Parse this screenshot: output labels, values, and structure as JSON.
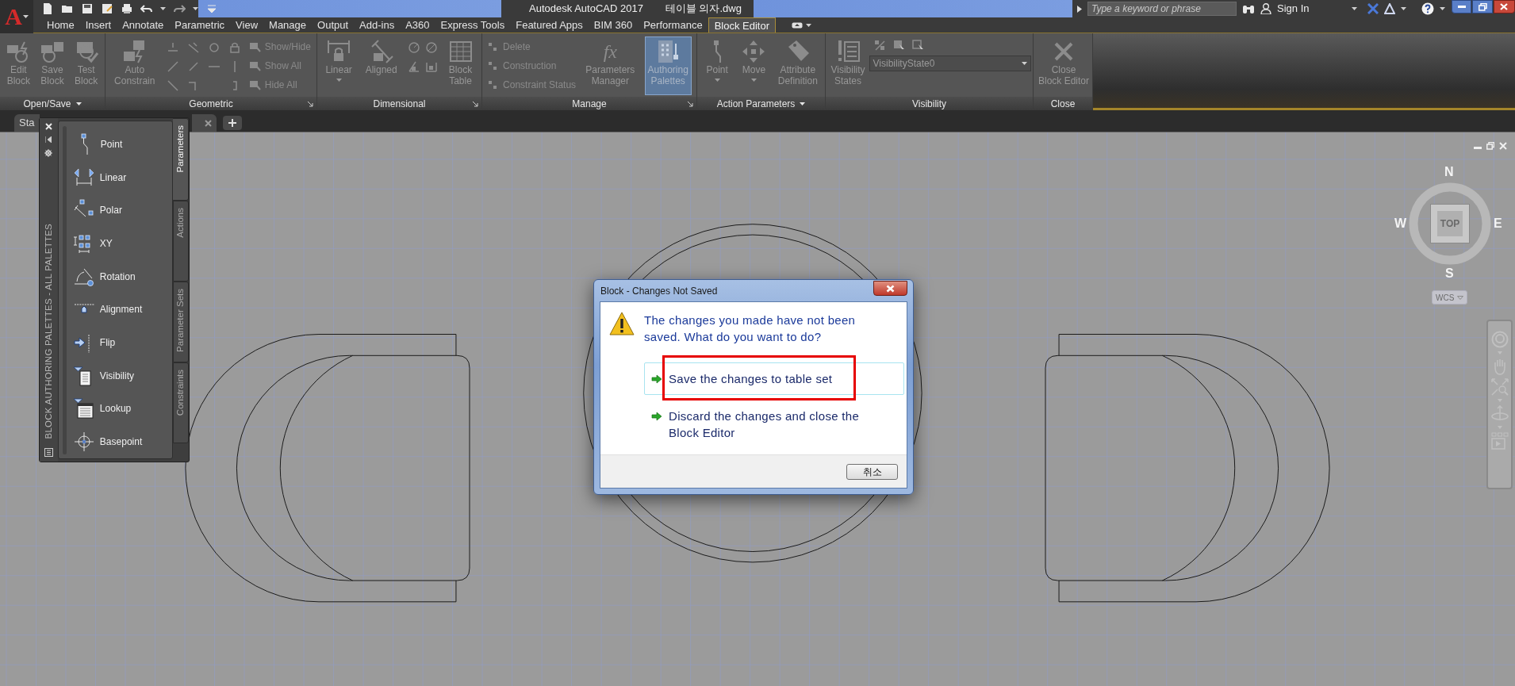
{
  "app_menu": {
    "label": "A"
  },
  "title_bar": {
    "app_title": "Autodesk AutoCAD 2017",
    "file_name": "테이블 의자.dwg",
    "search": {
      "placeholder": "Type a keyword or phrase"
    },
    "sign_in": "Sign In"
  },
  "ribbon_tabs": [
    {
      "label": "Home",
      "selected": false
    },
    {
      "label": "Insert",
      "selected": false
    },
    {
      "label": "Annotate",
      "selected": false
    },
    {
      "label": "Parametric",
      "selected": false
    },
    {
      "label": "View",
      "selected": false
    },
    {
      "label": "Manage",
      "selected": false
    },
    {
      "label": "Output",
      "selected": false
    },
    {
      "label": "Add-ins",
      "selected": false
    },
    {
      "label": "A360",
      "selected": false
    },
    {
      "label": "Express Tools",
      "selected": false
    },
    {
      "label": "Featured Apps",
      "selected": false
    },
    {
      "label": "BIM 360",
      "selected": false
    },
    {
      "label": "Performance",
      "selected": false
    },
    {
      "label": "Block Editor",
      "selected": true
    }
  ],
  "ribbon_panels": [
    {
      "label": "Open/Save",
      "menu": true,
      "launcher": false,
      "items": [
        {
          "kind": "large",
          "label": "Edit\nBlock",
          "active": false,
          "dropdown": false
        },
        {
          "kind": "large",
          "label": "Save\nBlock",
          "active": false,
          "dropdown": false
        },
        {
          "kind": "large",
          "label": "Test\nBlock",
          "active": false,
          "dropdown": false
        }
      ]
    },
    {
      "label": "Geometric",
      "menu": false,
      "launcher": true,
      "items": [
        {
          "kind": "large",
          "label": "Auto\nConstrain",
          "active": false,
          "dropdown": false
        },
        {
          "kind": "icon_grid"
        },
        {
          "kind": "small_list",
          "labels": [
            "Show/Hide",
            "Show All",
            "Hide All"
          ]
        }
      ]
    },
    {
      "label": "Dimensional",
      "menu": false,
      "launcher": true,
      "items": [
        {
          "kind": "large",
          "label": "Linear",
          "active": false,
          "dropdown": true
        },
        {
          "kind": "large",
          "label": "Aligned",
          "active": false,
          "dropdown": false
        },
        {
          "kind": "icon_grid"
        },
        {
          "kind": "large",
          "label": "Block\nTable",
          "active": false,
          "dropdown": false
        }
      ]
    },
    {
      "label": "Manage",
      "menu": false,
      "launcher": true,
      "items": [
        {
          "kind": "small_list",
          "labels": [
            "Delete",
            "Construction",
            "Constraint Status"
          ]
        },
        {
          "kind": "large",
          "glyph": "fx",
          "label": "Parameters\nManager",
          "active": false,
          "dropdown": false
        },
        {
          "kind": "large",
          "label": "Authoring\nPalettes",
          "active": true,
          "dropdown": false
        }
      ]
    },
    {
      "label": "Action Parameters",
      "menu": true,
      "launcher": false,
      "items": [
        {
          "kind": "large",
          "label": "Point",
          "active": false,
          "dropdown": true
        },
        {
          "kind": "large",
          "label": "Move",
          "active": false,
          "dropdown": true
        },
        {
          "kind": "large",
          "label": "Attribute\nDefinition",
          "active": false,
          "dropdown": false
        }
      ]
    },
    {
      "label": "Visibility",
      "menu": false,
      "launcher": false,
      "items": [
        {
          "kind": "large",
          "label": "Visibility\nStates",
          "active": false,
          "dropdown": false
        },
        {
          "kind": "visibility_tools",
          "value": "VisibilityState0"
        }
      ]
    },
    {
      "label": "Close",
      "menu": false,
      "launcher": false,
      "items": [
        {
          "kind": "large",
          "label": "Close\nBlock Editor",
          "active": false,
          "dropdown": false
        }
      ]
    }
  ],
  "doc_tabs": [
    {
      "label": "Sta",
      "closable": false
    },
    {
      "closable": true
    }
  ],
  "palette": {
    "title": "BLOCK AUTHORING PALETTES - ALL PALETTES",
    "tabs": [
      {
        "label": "Parameters",
        "selected": true
      },
      {
        "label": "Actions",
        "selected": false
      },
      {
        "label": "Parameter Sets",
        "selected": false
      },
      {
        "label": "Constraints",
        "selected": false
      }
    ],
    "items": [
      "Point",
      "Linear",
      "Polar",
      "XY",
      "Rotation",
      "Alignment",
      "Flip",
      "Visibility",
      "Lookup",
      "Basepoint"
    ]
  },
  "viewcube": {
    "face": "TOP",
    "north": "N",
    "south": "S",
    "east": "E",
    "west": "W",
    "ucs": "WCS"
  },
  "dialog": {
    "title": "Block - Changes Not Saved",
    "message": "The changes you made have not been saved. What do you want to do?",
    "options": [
      {
        "label": "Save the changes to table set",
        "selected": true,
        "highlighted": true
      },
      {
        "label": "Discard the changes and close the Block Editor",
        "selected": false,
        "highlighted": false
      }
    ],
    "cancel": "취소"
  }
}
